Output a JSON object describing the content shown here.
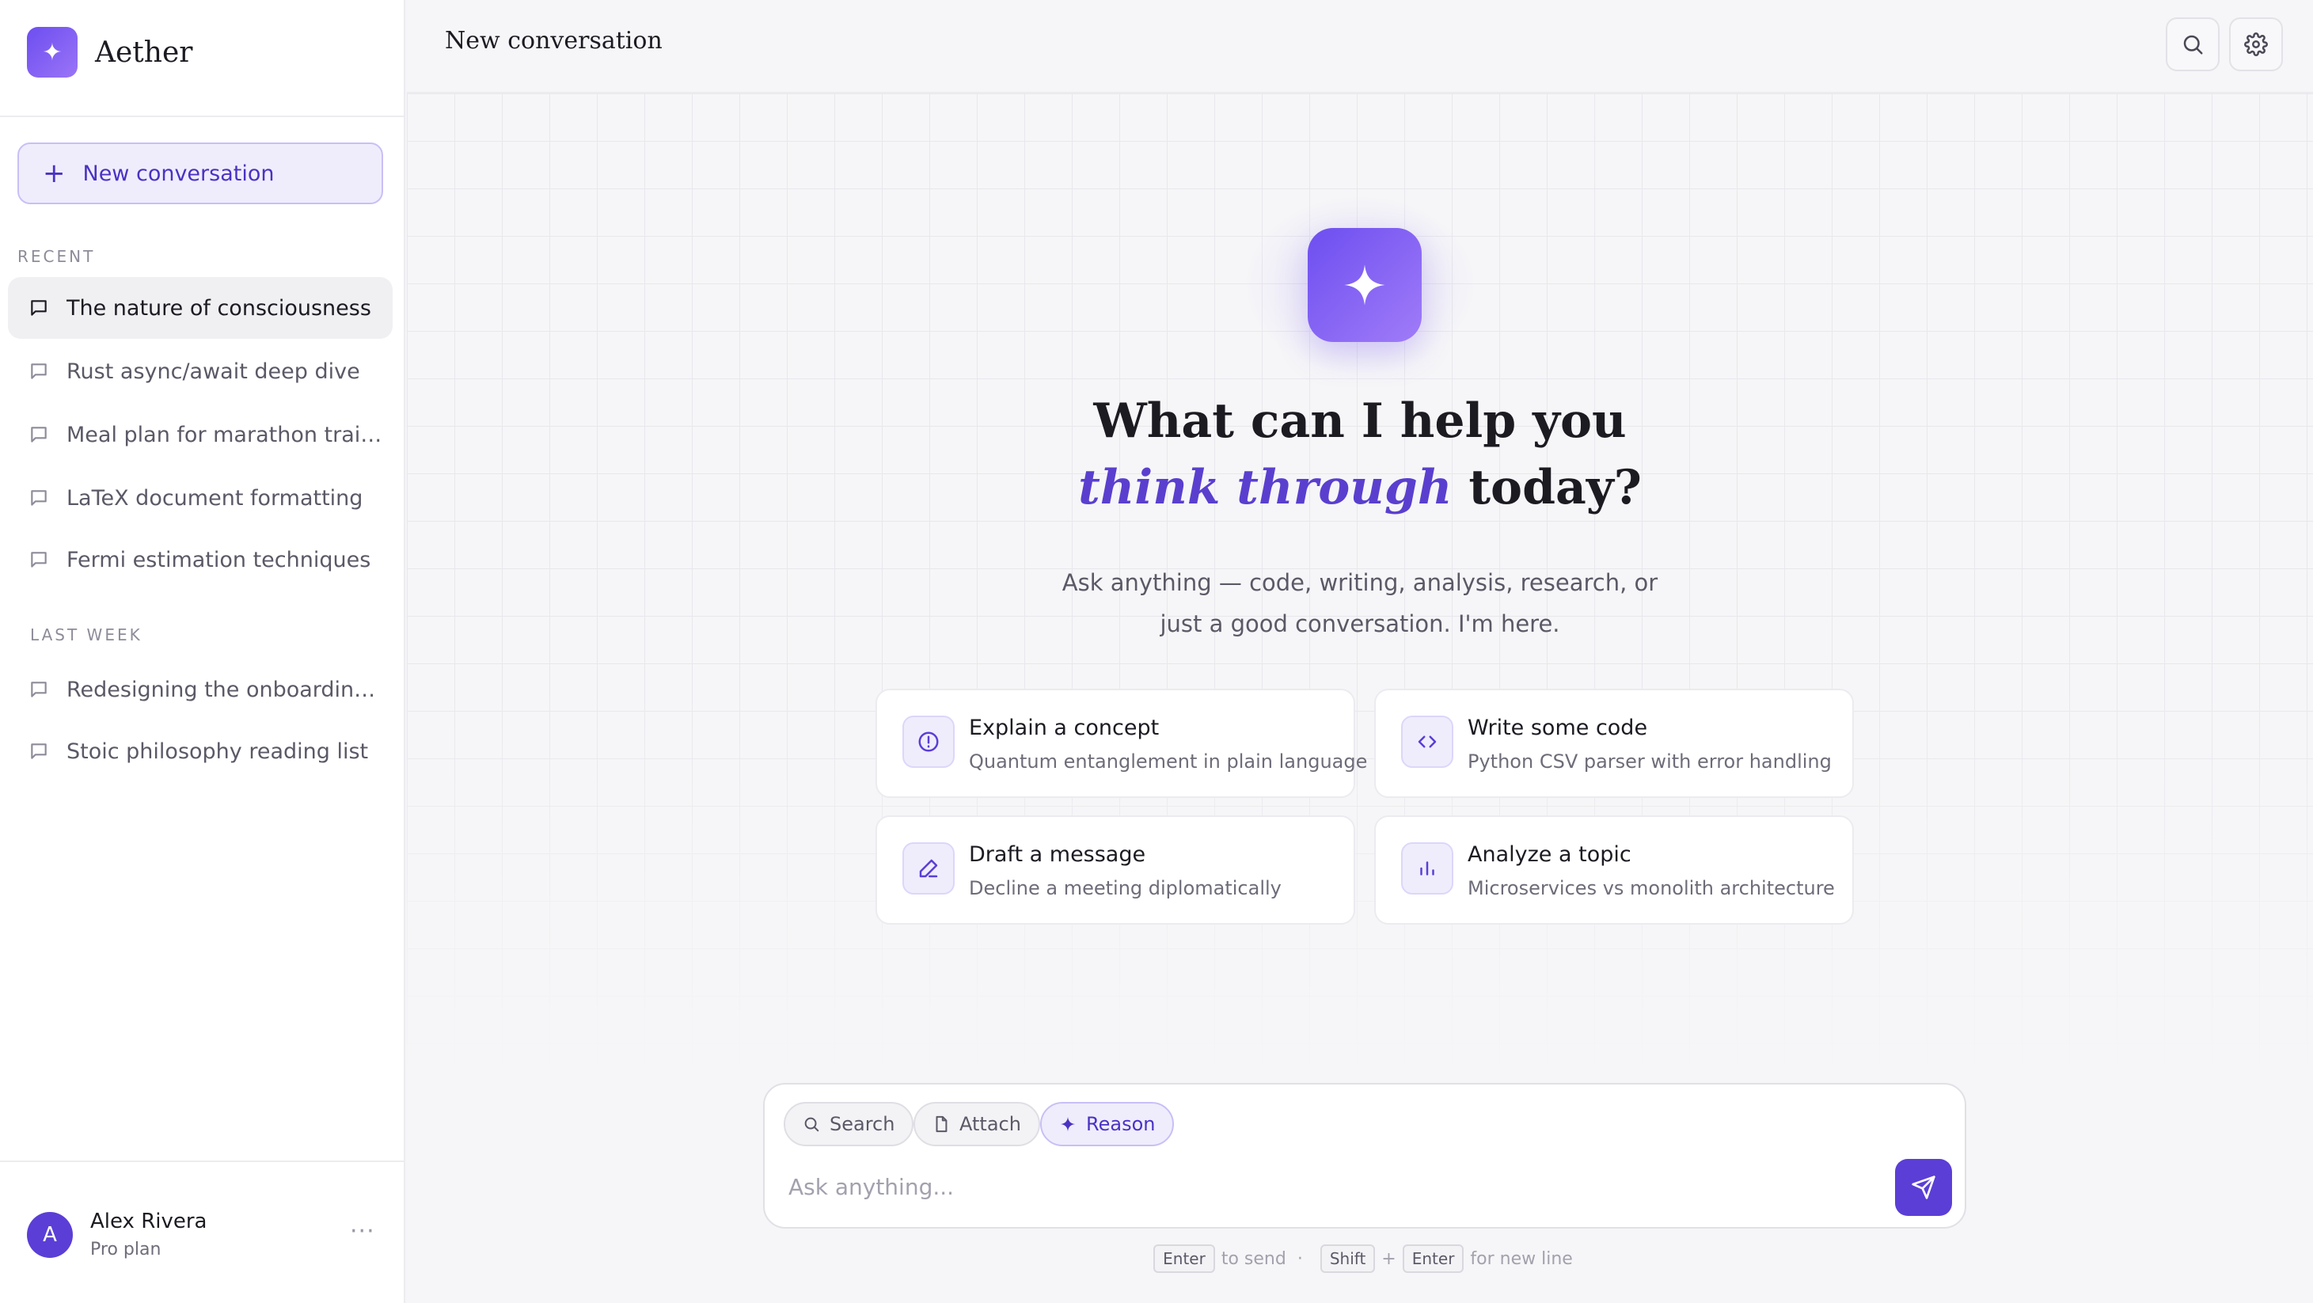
{
  "app": {
    "name": "Aether"
  },
  "sidebar": {
    "new_button_label": "New conversation",
    "recent_label": "RECENT",
    "recent_items": [
      {
        "label": "The nature of consciousness",
        "active": true
      },
      {
        "label": "Rust async/await deep dive"
      },
      {
        "label": "Meal plan for marathon training"
      },
      {
        "label": "LaTeX document formatting"
      },
      {
        "label": "Fermi estimation techniques"
      }
    ],
    "last_week_label": "LAST WEEK",
    "last_week_items": [
      {
        "label": "Redesigning the onboarding flow"
      },
      {
        "label": "Stoic philosophy reading list"
      }
    ],
    "user": {
      "initial": "A",
      "name": "Alex Rivera",
      "plan": "Pro plan",
      "more": "···"
    }
  },
  "header": {
    "title": "New conversation",
    "icons": [
      "search-icon",
      "gear-icon"
    ]
  },
  "hero": {
    "line1": "What can I help you",
    "accent": "think through",
    "line2_rest": "today?",
    "subtitle": "Ask anything — code, writing, analysis, research, or just a good conversation. I'm here."
  },
  "suggestions": [
    {
      "title": "Explain a concept",
      "subtitle": "Quantum entanglement in plain language",
      "icon": "info-icon"
    },
    {
      "title": "Write some code",
      "subtitle": "Python CSV parser with error handling",
      "icon": "code-icon"
    },
    {
      "title": "Draft a message",
      "subtitle": "Decline a meeting diplomatically",
      "icon": "pencil-icon"
    },
    {
      "title": "Analyze a topic",
      "subtitle": "Microservices vs monolith architecture",
      "icon": "bar-chart-icon"
    }
  ],
  "composer": {
    "chips": [
      {
        "label": "Search",
        "icon": "search-icon"
      },
      {
        "label": "Attach",
        "icon": "file-icon"
      },
      {
        "label": "Reason",
        "icon": "sparkle-icon",
        "active": true
      }
    ],
    "placeholder": "Ask anything...",
    "value": ""
  },
  "hint": {
    "enter_key": "Enter",
    "to_send": "to send",
    "dot": "·",
    "shift_key": "Shift",
    "plus": "+",
    "enter_key2": "Enter",
    "new_line": "for new line"
  },
  "colors": {
    "accent": "#5b3ed6",
    "accent_light": "#efedfc",
    "background": "#f6f6f8"
  }
}
